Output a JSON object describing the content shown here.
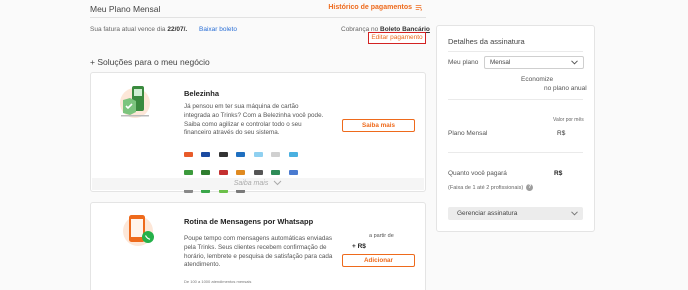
{
  "header": {
    "title": "Meu Plano Mensal",
    "history_link": "Histórico de pagamentos"
  },
  "invoice": {
    "due_prefix": "Sua fatura atual vence dia",
    "due_date": "22/07/.",
    "download_label": "Baixar boleto",
    "charge_prefix": "Cobrança no",
    "charge_method": "Boleto Bancário",
    "edit_payment_label": "Editar pagamento"
  },
  "solutions": {
    "title": "+ Soluções para o meu negócio",
    "cards": [
      {
        "name": "Belezinha",
        "description": "Já pensou em ter sua máquina de cartão integrada ao Trinks? Com a Belezinha você pode. Saiba como agilizar e controlar todo o seu financeiro através do seu sistema.",
        "button_label": "Saiba mais",
        "more_label": "Saiba mais"
      },
      {
        "name": "Rotina de Mensagens por Whatsapp",
        "description": "Poupe tempo com mensagens automáticas enviadas pela Trinks. Seus clientes recebem confirmação de horário, lembrete e pesquisa de satisfação para cada atendimento.",
        "price_from": "a partir de",
        "price": "+ R$",
        "button_label": "Adicionar",
        "fine_print": "De 100 a 1000 atendimentos mensais"
      }
    ]
  },
  "subscription": {
    "title": "Detalhes da assinatura",
    "plan_label": "Meu plano",
    "plan_value": "Mensal",
    "save_line1": "Economize",
    "save_line2": "no plano anual",
    "value_per_month": "Valor por mês",
    "monthly_plan_label": "Plano Mensal",
    "monthly_plan_value": "R$",
    "total_label": "Quanto você pagará",
    "total_value": "R$",
    "range_note": "(Faixa de 1 até 2 profissionais)",
    "help_icon": "?",
    "manage_label": "Gerenciar assinatura"
  },
  "colors": {
    "accent": "#ee6a1c",
    "link": "#2a6fd6",
    "highlight_border": "#d32222",
    "whatsapp_green": "#25b14a"
  },
  "icons": [
    "history-icon",
    "pos-terminal-icon",
    "phone-whatsapp-icon",
    "chevron-down-icon",
    "help-icon",
    "payment-brand-icons"
  ]
}
